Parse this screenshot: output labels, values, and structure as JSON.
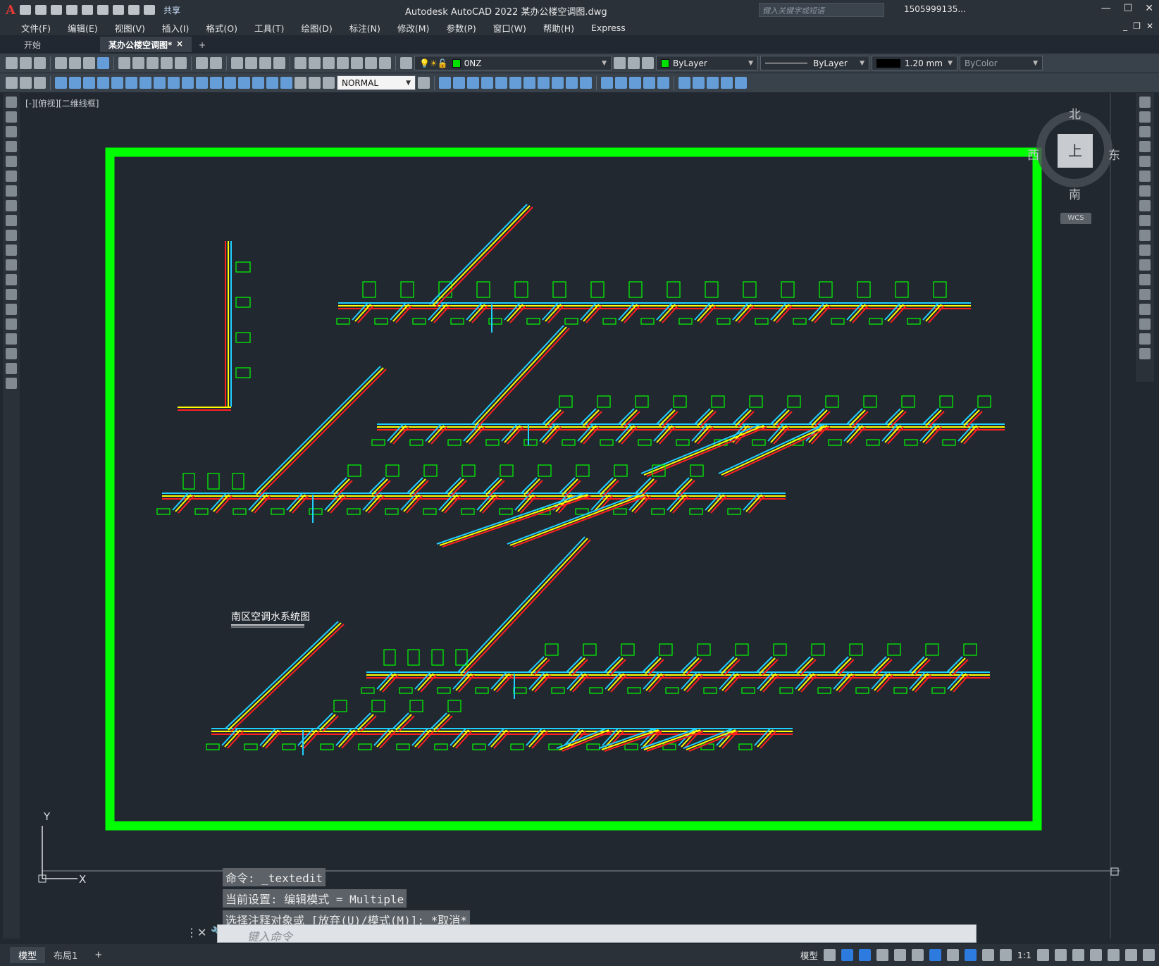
{
  "app": {
    "title": "Autodesk AutoCAD 2022    某办公楼空调图.dwg",
    "share": "共享",
    "search_placeholder": "键入关键字或短语",
    "account": "1505999135...",
    "logo": "A"
  },
  "menu": [
    "文件(F)",
    "编辑(E)",
    "视图(V)",
    "插入(I)",
    "格式(O)",
    "工具(T)",
    "绘图(D)",
    "标注(N)",
    "修改(M)",
    "参数(P)",
    "窗口(W)",
    "帮助(H)",
    "Express"
  ],
  "tabs": {
    "start": "开始",
    "active": "某办公楼空调图*",
    "close": "×",
    "add": "+"
  },
  "toolbar": {
    "layer": "0NZ",
    "color": "ByLayer",
    "linetype": "ByLayer",
    "lineweight": "1.20 mm",
    "plotstyle": "ByColor",
    "textstyle": "NORMAL"
  },
  "view": {
    "label": "[-][俯视][二维线框]"
  },
  "navcube": {
    "north": "北",
    "south": "南",
    "east": "东",
    "west": "西",
    "top": "上",
    "wcs": "WCS"
  },
  "drawing": {
    "title": "南区空调水系统图",
    "colors": {
      "frame": "#00ff00",
      "pipe_red": "#ff2020",
      "pipe_yellow": "#ffff00",
      "pipe_cyan": "#20d0ff",
      "label_green": "#00ff00"
    }
  },
  "ucs": {
    "x": "X",
    "y": "Y"
  },
  "command": {
    "history": [
      "命令: _textedit",
      "当前设置: 编辑模式 = Multiple",
      "选择注释对象或 [放弃(U)/模式(M)]: *取消*"
    ],
    "placeholder": "键入命令",
    "close": "×"
  },
  "status": {
    "layout_tabs": [
      "模型",
      "布局1"
    ],
    "add": "+",
    "model": "模型",
    "scale": "1:1"
  }
}
